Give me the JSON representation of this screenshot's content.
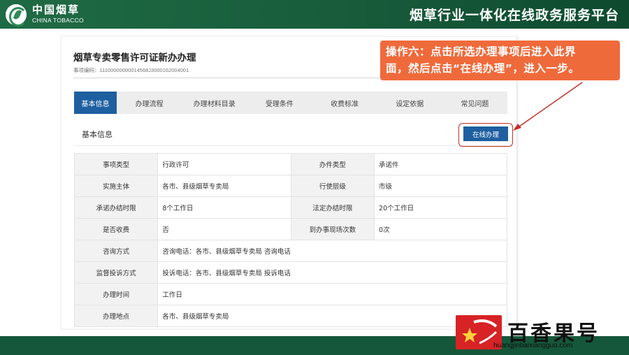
{
  "header": {
    "logo_cn": "中国烟草",
    "logo_en": "CHINA TOBACCO",
    "platform_title": "烟草行业一体化在线政务服务平台"
  },
  "item": {
    "title": "烟草专卖零售许可证新办办理",
    "code": "事项编码：11100000000014568J3000162004001"
  },
  "tabs": [
    {
      "label": "基本信息",
      "active": true
    },
    {
      "label": "办理流程"
    },
    {
      "label": "办理材料目录"
    },
    {
      "label": "受理条件"
    },
    {
      "label": "收费标准"
    },
    {
      "label": "设定依据"
    },
    {
      "label": "常见问题"
    }
  ],
  "section": {
    "label": "基本信息",
    "online_button": "在线办理"
  },
  "info_rows": [
    {
      "k1": "事项类型",
      "v1": "行政许可",
      "k2": "办件类型",
      "v2": "承诺件"
    },
    {
      "k1": "实施主体",
      "v1": "各市、县级烟草专卖局",
      "k2": "行使层级",
      "v2": "市级"
    },
    {
      "k1": "承诺办结时限",
      "v1": "8个工作日",
      "k2": "法定办结时限",
      "v2": "20个工作日"
    },
    {
      "k1": "是否收费",
      "v1": "否",
      "k2": "到办事现场次数",
      "v2": "0次"
    },
    {
      "k1": "咨询方式",
      "v1": "咨询电话：各市、县级烟草专卖局 咨询电话"
    },
    {
      "k1": "监督投诉方式",
      "v1": "投诉电话：各市、县级烟草专卖局 投诉电话"
    },
    {
      "k1": "办理时间",
      "v1": "工作日"
    },
    {
      "k1": "办理地点",
      "v1": "各市、县级烟草专卖局"
    }
  ],
  "callout": {
    "line1": "操作六：点击所选办理事项后进入此界",
    "line2": "面，然后点击“在线办理”，进入一步。"
  },
  "watermark": {
    "name": "百香果号",
    "url": "huangjinbaixiangguo.com"
  },
  "colors": {
    "banner_green": "#1f6b45",
    "tab_active_blue": "#1e5fa0",
    "callout_orange": "#ef6a3b",
    "highlight_red": "#c0302a"
  }
}
